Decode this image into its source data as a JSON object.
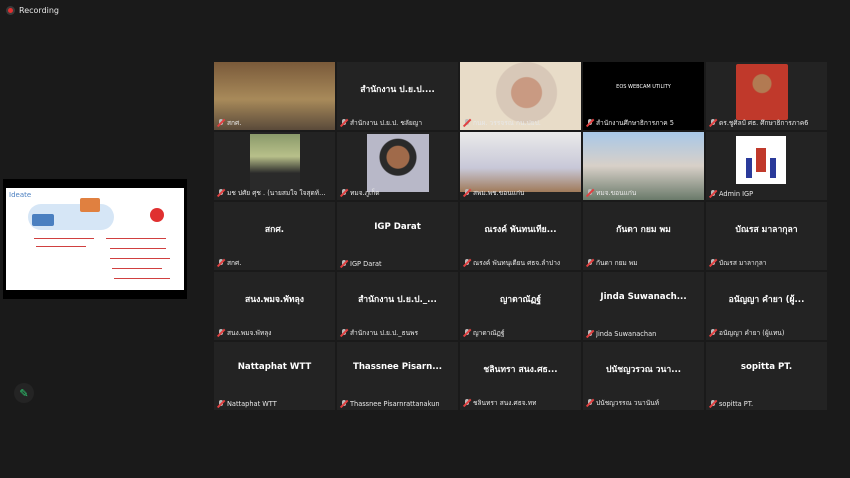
{
  "recording": {
    "label": "Recording"
  },
  "share": {
    "slide_title": "Ideate"
  },
  "grid": [
    {
      "center": "",
      "name": "สกศ.",
      "video": "office",
      "active": true
    },
    {
      "center": "สำนักงาน ป.ย.ป....",
      "name": "สำนักงาน ป.ย.ป. ชลัยญา"
    },
    {
      "center": "",
      "name": "กนผ. วรรจรณ กน.ปยป.",
      "video": "face"
    },
    {
      "center": "",
      "name": "สำนักงานศึกษาธิการภาค 5",
      "video": "webcam",
      "video_text": "EOS WEBCAM UTILITY"
    },
    {
      "center": "",
      "name": "ดร.ชูศิลป์ ศธ. ศึกษาธิการภาค6",
      "video": "man"
    },
    {
      "center": "",
      "name": "มช ปศัย ศุช . (นายสมใจ ใจสุดท้...",
      "video": "suit"
    },
    {
      "center": "",
      "name": "ทมจ.ภูเก็ต",
      "video": "woman"
    },
    {
      "center": "",
      "name": "สพม.พช.ขอนแก่น",
      "video": "meeting"
    },
    {
      "center": "",
      "name": "ทมจ.ขอนแก่น",
      "video": "city"
    },
    {
      "center": "",
      "name": "Admin IGP",
      "video": "logo"
    },
    {
      "center": "สกศ.",
      "name": "สกศ."
    },
    {
      "center": "IGP Darat",
      "name": "IGP Darat"
    },
    {
      "center": "ณรงค์ พันทนเทีย...",
      "name": "ณรงค์ พันทนุเตียน ศธจ.ลำปาง"
    },
    {
      "center": "กันดา กยม พม",
      "name": "กันดา กยม พม"
    },
    {
      "center": "บัณรส มาลากุลา",
      "name": "บัณรส มาลากุลา"
    },
    {
      "center": "สนง.พมจ.พัทลุง",
      "name": "สนง.พมจ.พัทลุง"
    },
    {
      "center": "สำนักงาน ป.ย.ป._...",
      "name": "สำนักงาน ป.ย.ป._ธนพร"
    },
    {
      "center": "ญาดาณัฏฐ์",
      "name": "ญาดาณัฏฐ์"
    },
    {
      "center": "Jinda Suwanach...",
      "name": "Jinda Suwanachan"
    },
    {
      "center": "อนัญญา คำยา (ผู้...",
      "name": "อนัญญา คำยา (ผู้แทน)"
    },
    {
      "center": "Nattaphat WTT",
      "name": "Nattaphat WTT"
    },
    {
      "center": "Thassnee Pisarn...",
      "name": "Thassnee Pisarnrattanakun"
    },
    {
      "center": "ชลินทรา สนง.ศธ...",
      "name": "ชลินทรา สนง.ศธจ.ทท"
    },
    {
      "center": "ปนัชญวรวณ วนา...",
      "name": "ปนัชญวรรณ วนานันท์"
    },
    {
      "center": "sopitta PT.",
      "name": "sopitta PT."
    }
  ]
}
